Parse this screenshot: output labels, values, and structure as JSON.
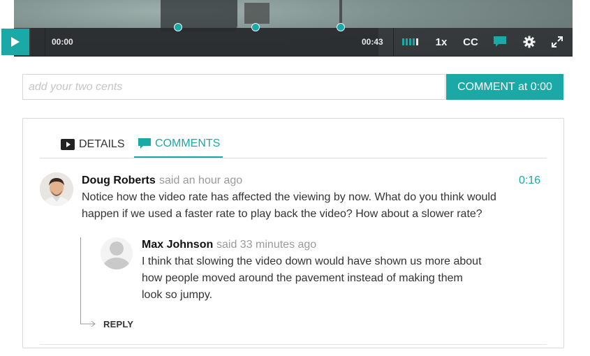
{
  "player": {
    "current_time": "00:00",
    "duration": "00:43",
    "speed_label": "1x",
    "cc_label": "CC",
    "icons": [
      "play-icon",
      "volume-bars-icon",
      "comment-bubble-icon",
      "gear-icon",
      "fullscreen-icon"
    ],
    "accent_color": "#1aa9a6"
  },
  "comment_form": {
    "placeholder": "add your two cents",
    "value": "",
    "button_label": "COMMENT at 0:00"
  },
  "tabs": [
    {
      "label": "DETAILS",
      "icon": "video-play-icon",
      "active": false
    },
    {
      "label": "COMMENTS",
      "icon": "comment-icon",
      "active": true
    }
  ],
  "comments": [
    {
      "author": "Doug Roberts",
      "meta": "said an hour ago",
      "timestamp": "0:16",
      "lines": [
        "Notice how the video rate has affected the viewing by now. What do you think would",
        "happen if we used a faster rate to play back the video? How about a slower rate?"
      ],
      "replies": [
        {
          "author": "Max Johnson",
          "meta": "said 33 minutes ago",
          "lines": [
            "I think that slowing the video down would have shown us more about",
            "how people moved around the pavement instead of making them",
            "look so jumpy."
          ]
        }
      ],
      "reply_label": "REPLY"
    }
  ]
}
